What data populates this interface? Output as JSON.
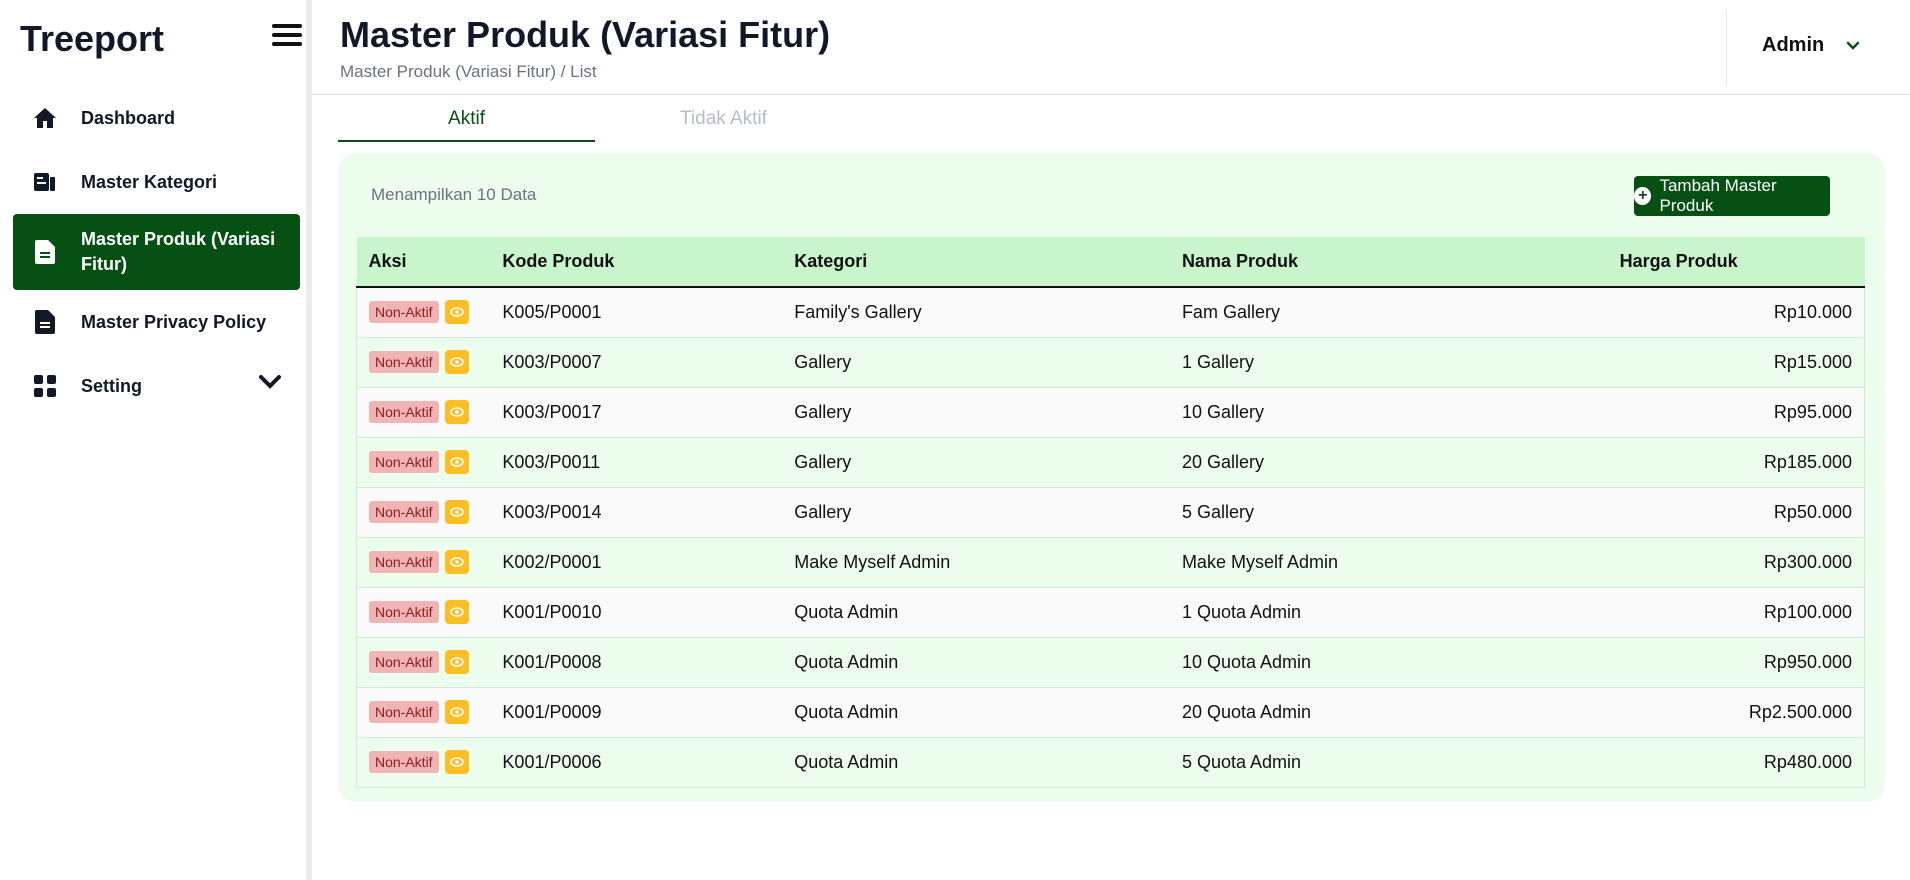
{
  "app": {
    "title": "Treeport"
  },
  "sidebar": {
    "items": [
      {
        "label": "Dashboard",
        "icon": "home-icon"
      },
      {
        "label": "Master Kategori",
        "icon": "category-icon"
      },
      {
        "label": "Master Produk (Variasi Fitur)",
        "icon": "document-icon",
        "active": true
      },
      {
        "label": "Master Privacy Policy",
        "icon": "document-icon"
      },
      {
        "label": "Setting",
        "icon": "grid-icon",
        "has_submenu": true
      }
    ]
  },
  "header": {
    "title": "Master Produk (Variasi Fitur)",
    "breadcrumb": "Master Produk (Variasi Fitur) / List",
    "user": "Admin"
  },
  "tabs": [
    {
      "label": "Aktif",
      "active": true
    },
    {
      "label": "Tidak Aktif",
      "active": false
    }
  ],
  "main": {
    "count_text": "Menampilkan 10 Data",
    "add_button": "Tambah Master Produk"
  },
  "table": {
    "columns": [
      "Aksi",
      "Kode Produk",
      "Kategori",
      "Nama Produk",
      "Harga Produk"
    ],
    "rows": [
      {
        "action": "Non-Aktif",
        "kode": "K005/P0001",
        "kategori": "Family's Gallery",
        "nama": "Fam Gallery",
        "harga": "Rp10.000"
      },
      {
        "action": "Non-Aktif",
        "kode": "K003/P0007",
        "kategori": "Gallery",
        "nama": "1 Gallery",
        "harga": "Rp15.000"
      },
      {
        "action": "Non-Aktif",
        "kode": "K003/P0017",
        "kategori": "Gallery",
        "nama": "10 Gallery",
        "harga": "Rp95.000"
      },
      {
        "action": "Non-Aktif",
        "kode": "K003/P0011",
        "kategori": "Gallery",
        "nama": "20 Gallery",
        "harga": "Rp185.000"
      },
      {
        "action": "Non-Aktif",
        "kode": "K003/P0014",
        "kategori": "Gallery",
        "nama": "5 Gallery",
        "harga": "Rp50.000"
      },
      {
        "action": "Non-Aktif",
        "kode": "K002/P0001",
        "kategori": "Make Myself Admin",
        "nama": "Make Myself Admin",
        "harga": "Rp300.000"
      },
      {
        "action": "Non-Aktif",
        "kode": "K001/P0010",
        "kategori": "Quota Admin",
        "nama": "1 Quota Admin",
        "harga": "Rp100.000"
      },
      {
        "action": "Non-Aktif",
        "kode": "K001/P0008",
        "kategori": "Quota Admin",
        "nama": "10 Quota Admin",
        "harga": "Rp950.000"
      },
      {
        "action": "Non-Aktif",
        "kode": "K001/P0009",
        "kategori": "Quota Admin",
        "nama": "20 Quota Admin",
        "harga": "Rp2.500.000"
      },
      {
        "action": "Non-Aktif",
        "kode": "K001/P0006",
        "kategori": "Quota Admin",
        "nama": "5 Quota Admin",
        "harga": "Rp480.000"
      }
    ]
  },
  "colors": {
    "primary": "#065014",
    "header_row": "#c8f5cc",
    "card_bg": "#ecfdee",
    "badge_bg": "#f1b4b4",
    "eye_button": "#fbbf24"
  }
}
